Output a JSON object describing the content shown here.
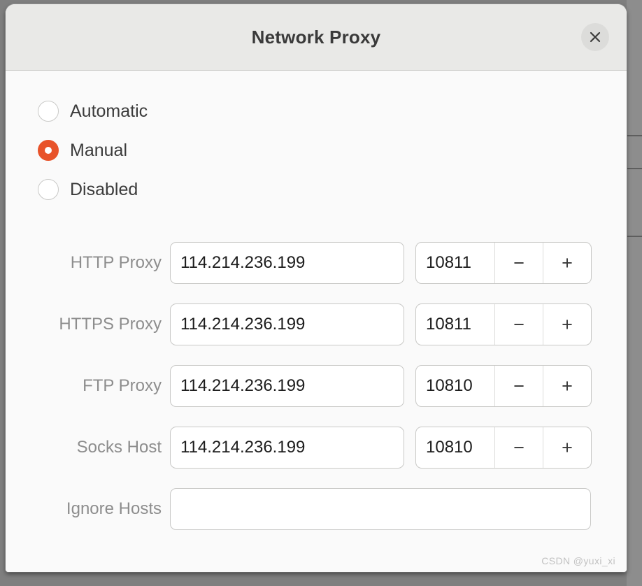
{
  "window": {
    "title": "Network Proxy",
    "close_icon": "close-icon"
  },
  "colors": {
    "accent": "#e8532a",
    "header_bg": "#e9e9e7",
    "body_bg": "#fafafa",
    "label_text": "#8d8d8d",
    "value_text": "#1d1d1d"
  },
  "mode": {
    "selected": "Manual",
    "options": [
      {
        "label": "Automatic",
        "checked": false
      },
      {
        "label": "Manual",
        "checked": true
      },
      {
        "label": "Disabled",
        "checked": false
      }
    ]
  },
  "fields": [
    {
      "label": "HTTP Proxy",
      "host": "114.214.236.199",
      "port": "10811",
      "minus": "−",
      "plus": "+"
    },
    {
      "label": "HTTPS Proxy",
      "host": "114.214.236.199",
      "port": "10811",
      "minus": "−",
      "plus": "+"
    },
    {
      "label": "FTP Proxy",
      "host": "114.214.236.199",
      "port": "10810",
      "minus": "−",
      "plus": "+"
    },
    {
      "label": "Socks Host",
      "host": "114.214.236.199",
      "port": "10810",
      "minus": "−",
      "plus": "+"
    }
  ],
  "ignore_hosts": {
    "label": "Ignore Hosts",
    "value": "",
    "placeholder": ""
  },
  "watermark": "CSDN @yuxi_xi"
}
